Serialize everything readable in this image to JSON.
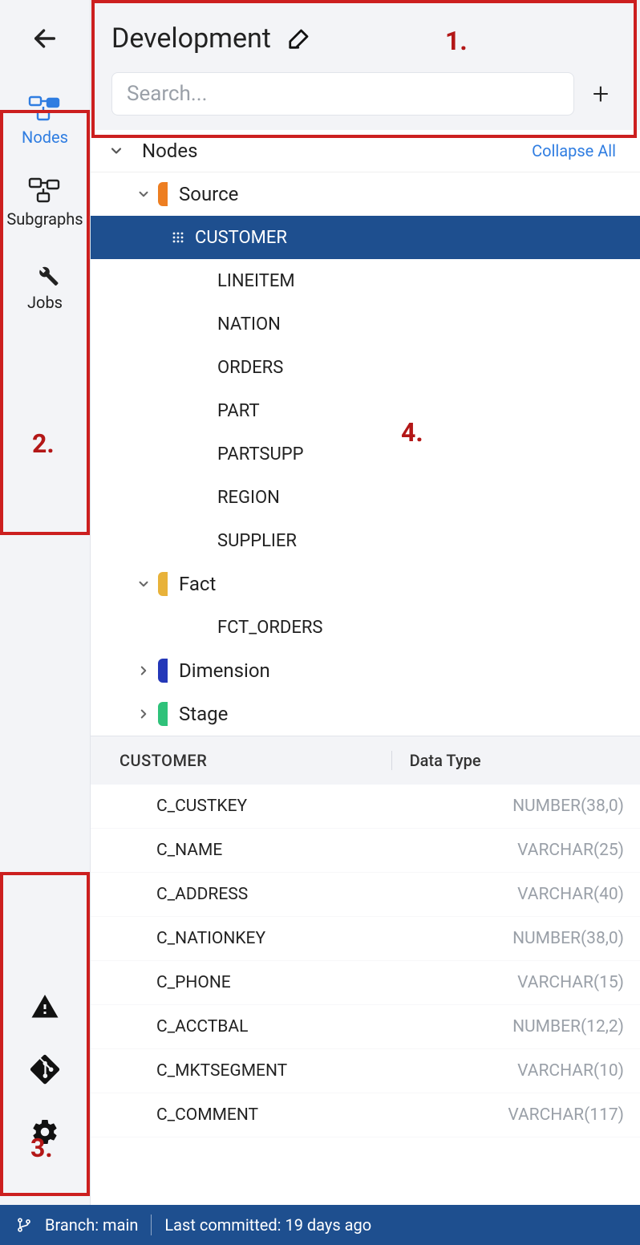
{
  "header": {
    "title": "Development",
    "search_placeholder": "Search..."
  },
  "sidebar": {
    "top": [
      {
        "name": "Nodes",
        "active": true
      },
      {
        "name": "Subgraphs",
        "active": false
      },
      {
        "name": "Jobs",
        "active": false
      }
    ]
  },
  "tree": {
    "root_label": "Nodes",
    "collapse_label": "Collapse All",
    "groups": [
      {
        "name": "Source",
        "color": "orange",
        "expanded": true,
        "items": [
          "CUSTOMER",
          "LINEITEM",
          "NATION",
          "ORDERS",
          "PART",
          "PARTSUPP",
          "REGION",
          "SUPPLIER"
        ],
        "selected": "CUSTOMER"
      },
      {
        "name": "Fact",
        "color": "yellow",
        "expanded": true,
        "items": [
          "FCT_ORDERS"
        ]
      },
      {
        "name": "Dimension",
        "color": "blue",
        "expanded": false,
        "items": []
      },
      {
        "name": "Stage",
        "color": "green",
        "expanded": false,
        "items": []
      }
    ]
  },
  "columns": {
    "table_name": "CUSTOMER",
    "dt_header": "Data Type",
    "rows": [
      {
        "name": "C_CUSTKEY",
        "type": "NUMBER(38,0)"
      },
      {
        "name": "C_NAME",
        "type": "VARCHAR(25)"
      },
      {
        "name": "C_ADDRESS",
        "type": "VARCHAR(40)"
      },
      {
        "name": "C_NATIONKEY",
        "type": "NUMBER(38,0)"
      },
      {
        "name": "C_PHONE",
        "type": "VARCHAR(15)"
      },
      {
        "name": "C_ACCTBAL",
        "type": "NUMBER(12,2)"
      },
      {
        "name": "C_MKTSEGMENT",
        "type": "VARCHAR(10)"
      },
      {
        "name": "C_COMMENT",
        "type": "VARCHAR(117)"
      }
    ]
  },
  "footer": {
    "branch_label": "Branch: main",
    "commit_label": "Last committed: 19 days ago"
  },
  "annotations": {
    "a1": "1.",
    "a2": "2.",
    "a3": "3.",
    "a4": "4."
  }
}
